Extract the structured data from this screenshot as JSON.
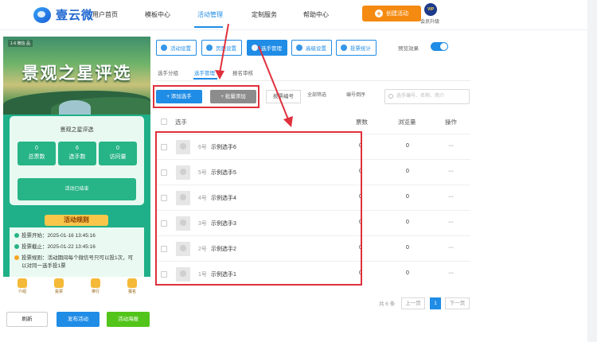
{
  "app": {
    "logo_text": "壹云微"
  },
  "nav": {
    "items": [
      "用户首页",
      "模板中心",
      "活动管理",
      "定制服务",
      "帮助中心"
    ],
    "active": "活动管理",
    "create_label": "创建活动",
    "vip_badge": "VIP",
    "vip_label": "会员升级"
  },
  "preview": {
    "banner_tag": "1-6 微信 品",
    "banner_title": "景观之星评选",
    "card_title": "景观之星评选",
    "stats": [
      {
        "value": "0",
        "label": "总票数"
      },
      {
        "value": "6",
        "label": "选手数"
      },
      {
        "value": "0",
        "label": "访问量"
      }
    ],
    "ended_text": "活动已结束",
    "rules_heading": "活动规则",
    "rules": [
      "投票开始：2025-01-16 13:45:16",
      "投票截止：2025-01-22 13:45:16",
      "投票规则：活动期间每个微信号只可以投1次，可",
      "以对同一选手投1票"
    ],
    "tabs": [
      "介绍",
      "投票",
      "排行",
      "报名"
    ]
  },
  "bottom_actions": {
    "refresh": "刷新",
    "publish": "发布活动",
    "poster": "活动海报"
  },
  "settings_tabs": [
    "活动设置",
    "页面设置",
    "选手管理",
    "高级设置",
    "投票统计"
  ],
  "settings_active": "选手管理",
  "preview_toggle_label": "预览效果",
  "preview_toggle_on": true,
  "sub_tabs": [
    "选手分组",
    "选手管理",
    "报名审核"
  ],
  "sub_active": "选手管理",
  "toolbar": {
    "add": "+ 添加选手",
    "batch": "+ 批量添加",
    "sort": "按票编号",
    "filter": "全部筛选",
    "order": "编号倒序",
    "search_placeholder": "选手编号、名称、简介"
  },
  "table": {
    "headers": {
      "contestant": "选手",
      "votes": "票数",
      "views": "浏览量",
      "ops": "操作"
    },
    "rows": [
      {
        "no": "6号",
        "name": "示例选手6",
        "votes": "0",
        "views": "0",
        "ops": "···"
      },
      {
        "no": "5号",
        "name": "示例选手5",
        "votes": "0",
        "views": "0",
        "ops": "···"
      },
      {
        "no": "4号",
        "name": "示例选手4",
        "votes": "0",
        "views": "0",
        "ops": "···"
      },
      {
        "no": "3号",
        "name": "示例选手3",
        "votes": "0",
        "views": "0",
        "ops": "···"
      },
      {
        "no": "2号",
        "name": "示例选手2",
        "votes": "0",
        "views": "0",
        "ops": "···"
      },
      {
        "no": "1号",
        "name": "示例选手1",
        "votes": "0",
        "views": "0",
        "ops": "···"
      }
    ]
  },
  "pagination": {
    "total": "共 6 条",
    "prev": "上一页",
    "current": "1",
    "next": "下一页"
  }
}
